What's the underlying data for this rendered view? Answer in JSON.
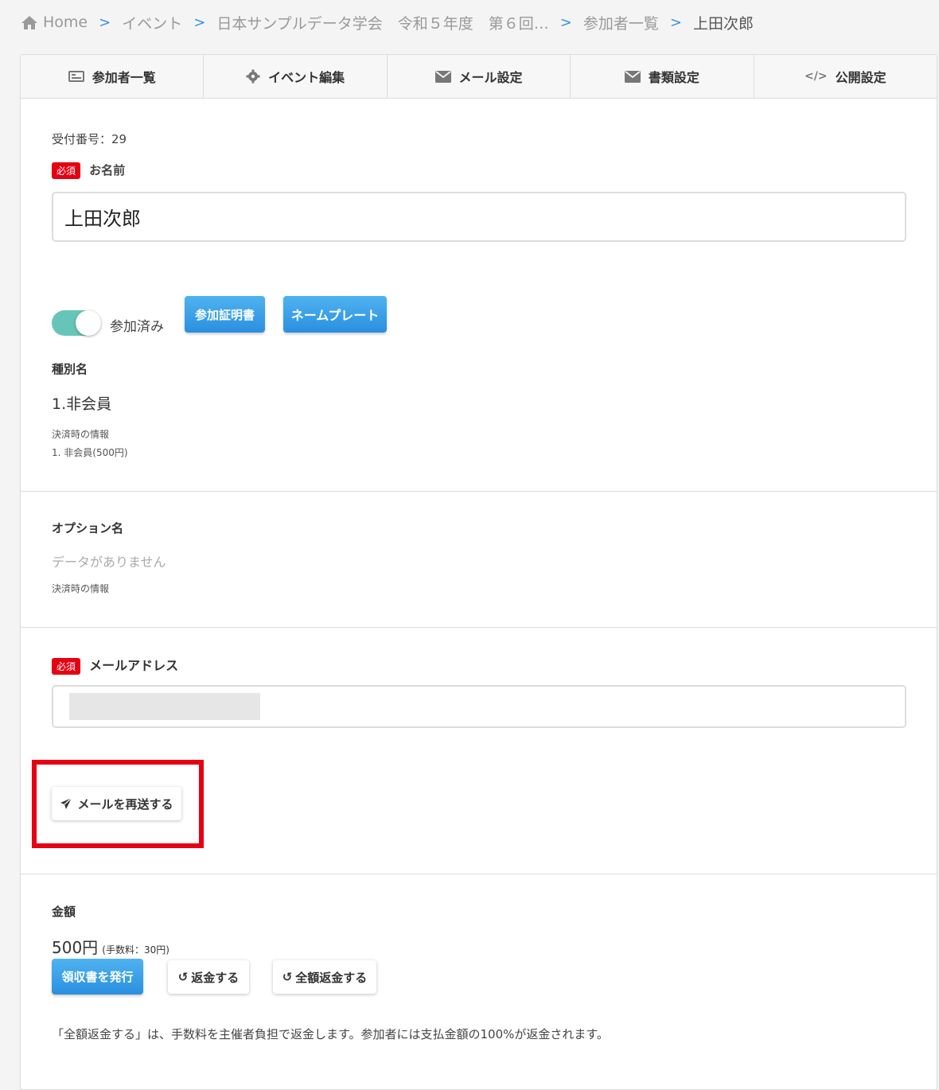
{
  "breadcrumb": {
    "home": "Home",
    "event": "イベント",
    "event_name": "日本サンプルデータ学会　令和５年度　第６回…",
    "list": "参加者一覧",
    "current": "上田次郎"
  },
  "tabs": [
    {
      "label": "参加者一覧",
      "icon": "id-card-icon"
    },
    {
      "label": "イベント編集",
      "icon": "gear-icon"
    },
    {
      "label": "メール設定",
      "icon": "envelope-icon"
    },
    {
      "label": "書類設定",
      "icon": "envelope-icon"
    },
    {
      "label": "公開設定",
      "icon": "code-icon"
    }
  ],
  "receipt": {
    "text": "受付番号：29"
  },
  "name_field": {
    "badge": "必須",
    "label": "お名前",
    "value": "上田次郎"
  },
  "attendance": {
    "toggle_label": "参加済み",
    "toggle_on": true,
    "certificate_button": "参加証明書",
    "nameplate_button": "ネームプレート"
  },
  "category": {
    "label": "種別名",
    "value": "1.非会員",
    "payment_info_label": "決済時の情報",
    "payment_info_value": "1.  非会員(500円)"
  },
  "option": {
    "label": "オプション名",
    "empty_text": "データがありません",
    "payment_info_label": "決済時の情報"
  },
  "email_field": {
    "badge": "必須",
    "label": "メールアドレス",
    "value": ""
  },
  "resend_button": "メールを再送する",
  "amount": {
    "label": "金額",
    "value": "500円",
    "fee": "(手数料：30円)",
    "receipt_button": "領収書を発行",
    "refund_button": "返金する",
    "full_refund_button": "全額返金する",
    "note": "「全額返金する」は、手数料を主催者負担で返金します。参加者には支払金額の100%が返金されます。"
  },
  "colors": {
    "accent": "#2a8fe0",
    "required": "#e60012",
    "toggle": "#66c5b8",
    "highlight": "#e60012"
  }
}
